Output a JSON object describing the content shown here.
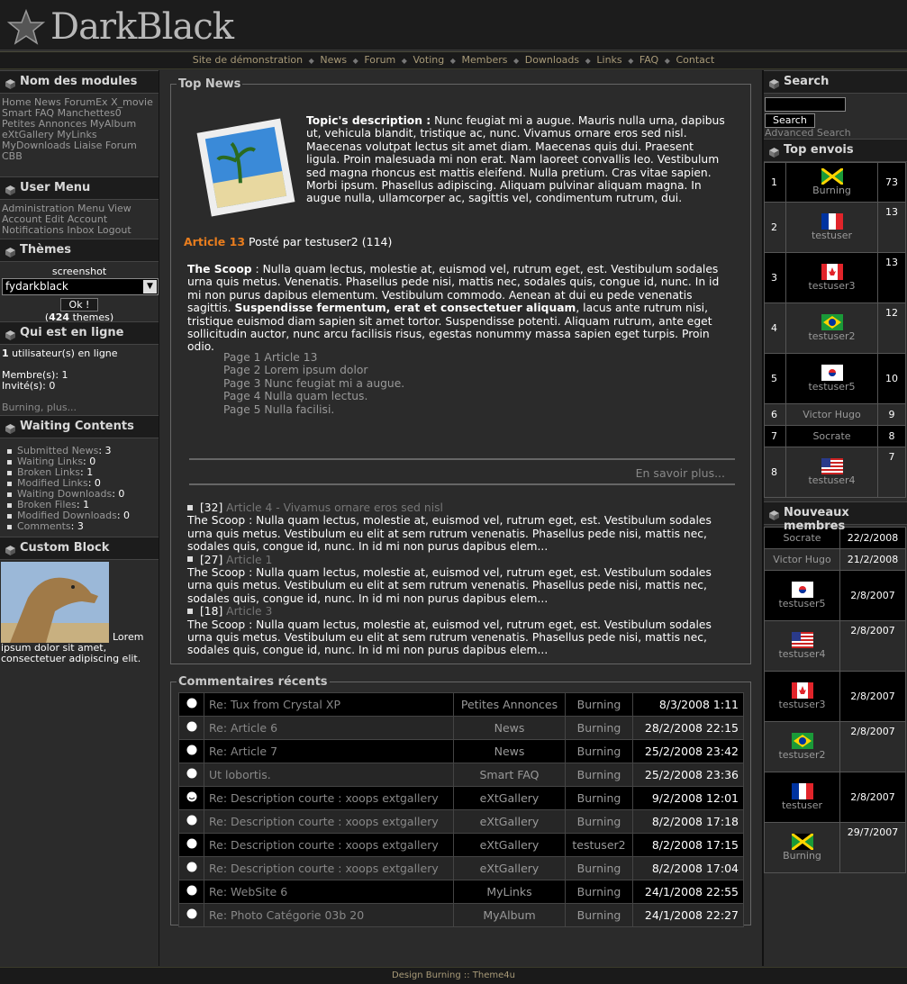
{
  "header": {
    "logo_text": "DarkBlack"
  },
  "nav": [
    "Site de démonstration",
    "News",
    "Forum",
    "Voting",
    "Members",
    "Downloads",
    "Links",
    "FAQ",
    "Contact"
  ],
  "left": {
    "modules": {
      "title": "Nom des modules",
      "items": [
        "Home",
        "News",
        "ForumEx",
        "X_movie",
        "Smart FAQ",
        "Manchettes0",
        "Petites Annonces",
        "MyAlbum",
        "eXtGallery",
        "MyLinks",
        "MyDownloads",
        "Liaise",
        "Forum",
        "CBB"
      ]
    },
    "usermenu": {
      "title": "User Menu",
      "items": [
        "Administration Menu",
        "View Account",
        "Edit Account",
        "Notifications",
        "Inbox",
        "Logout"
      ]
    },
    "themes": {
      "title": "Thèmes",
      "screenshot_label": "screenshot",
      "selected": "fydarkblack",
      "ok_label": "Ok !",
      "count": "424",
      "count_suffix": "themes"
    },
    "online": {
      "title": "Qui est en ligne",
      "users_count": "1",
      "users_label": "utilisateur(s) en ligne",
      "members_label": "Membre(s):",
      "members_count": "1",
      "guests_label": "Invité(s):",
      "guests_count": "0",
      "link": "Burning, plus..."
    },
    "waiting": {
      "title": "Waiting Contents",
      "items": [
        {
          "label": "Submitted News",
          "count": "3"
        },
        {
          "label": "Waiting Links",
          "count": "0"
        },
        {
          "label": "Broken Links",
          "count": "1"
        },
        {
          "label": "Modified Links",
          "count": "0"
        },
        {
          "label": "Waiting Downloads",
          "count": "0"
        },
        {
          "label": "Broken Files",
          "count": "1"
        },
        {
          "label": "Modified Downloads",
          "count": "0"
        },
        {
          "label": "Comments",
          "count": "3"
        }
      ]
    },
    "custom": {
      "title": "Custom Block",
      "text": "Lorem ipsum dolor sit amet, consectetuer adipiscing elit."
    }
  },
  "center": {
    "topnews": {
      "title": "Top News",
      "desc_label": "Topic's description :",
      "desc_text": "Nunc feugiat mi a augue. Mauris nulla urna, dapibus ut, vehicula blandit, tristique ac, nunc. Vivamus ornare eros sed nisl. Maecenas volutpat lectus sit amet diam. Maecenas quis dui. Praesent ligula. Proin malesuada mi non erat. Nam laoreet convallis leo. Vestibulum sed magna rhoncus est mattis eleifend. Nulla pretium. Cras vitae sapien. Morbi ipsum. Phasellus adipiscing. Aliquam pulvinar aliquam magna. In augue nulla, ullamcorper ac, sagittis vel, condimentum rutrum, dui.",
      "article_title": "Article 13",
      "posted_by": "Posté par testuser2 (114)",
      "scoop_label": "The Scoop",
      "body1": " : Nulla quam lectus, molestie at, euismod vel, rutrum eget, est. Vestibulum sodales urna quis metus. Venenatis. Phasellus pede nisi, mattis nec, sodales quis, congue id, nunc. In id mi non purus dapibus elementum. Vestibulum commodo. Aenean at dui eu pede venenatis sagittis. ",
      "body_bold": "Suspendisse fermentum, erat et consectetuer aliquam",
      "body2": ", lacus ante rutrum nisi, tristique euismod diam sapien sit amet tortor. Suspendisse potenti. Aliquam rutrum, ante eget sollicitudin auctor, nunc arcu facilisis risus, egestas nonummy massa sapien eget turpis. Proin odio.",
      "pages": [
        "Page 1 Article 13",
        "Page 2 Lorem ipsum dolor",
        "Page 3 Nunc feugiat mi a augue.",
        "Page 4 Nulla quam lectus.",
        "Page 5 Nulla facilisi."
      ],
      "more": "En savoir plus...",
      "list": [
        {
          "count": "[32]",
          "title": "Article 4 - Vivamus ornare eros sed nisl",
          "text": "The Scoop : Nulla quam lectus, molestie at, euismod vel, rutrum eget, est. Vestibulum sodales urna quis metus. Vestibulum eu elit at sem rutrum venenatis. Phasellus pede nisi, mattis nec, sodales quis, congue id, nunc. In id mi non purus dapibus elem..."
        },
        {
          "count": "[27]",
          "title": "Article 1",
          "text": "The Scoop : Nulla quam lectus, molestie at, euismod vel, rutrum eget, est. Vestibulum sodales urna quis metus. Vestibulum eu elit at sem rutrum venenatis. Phasellus pede nisi, mattis nec, sodales quis, congue id, nunc. In id mi non purus dapibus elem..."
        },
        {
          "count": "[18]",
          "title": "Article 3",
          "text": "The Scoop : Nulla quam lectus, molestie at, euismod vel, rutrum eget, est. Vestibulum sodales urna quis metus. Vestibulum eu elit at sem rutrum venenatis. Phasellus pede nisi, mattis nec, sodales quis, congue id, nunc. In id mi non purus dapibus elem..."
        }
      ]
    },
    "comments": {
      "title": "Commentaires récents",
      "rows": [
        {
          "subject": "Re: Tux from Crystal XP",
          "module": "Petites Annonces",
          "user": "Burning",
          "date": "8/3/2008 1:11"
        },
        {
          "subject": "Re: Article 6",
          "module": "News",
          "user": "Burning",
          "date": "28/2/2008 22:15"
        },
        {
          "subject": "Re: Article 7",
          "module": "News",
          "user": "Burning",
          "date": "25/2/2008 23:42"
        },
        {
          "subject": "Ut lobortis.",
          "module": "Smart FAQ",
          "user": "Burning",
          "date": "25/2/2008 23:36"
        },
        {
          "subject": "Re: Description courte : xoops extgallery",
          "module": "eXtGallery",
          "user": "Burning",
          "date": "9/2/2008 12:01"
        },
        {
          "subject": "Re: Description courte : xoops extgallery",
          "module": "eXtGallery",
          "user": "Burning",
          "date": "8/2/2008 17:18"
        },
        {
          "subject": "Re: Description courte : xoops extgallery",
          "module": "eXtGallery",
          "user": "testuser2",
          "date": "8/2/2008 17:15"
        },
        {
          "subject": "Re: Description courte : xoops extgallery",
          "module": "eXtGallery",
          "user": "Burning",
          "date": "8/2/2008 17:04"
        },
        {
          "subject": "Re: WebSite 6",
          "module": "MyLinks",
          "user": "Burning",
          "date": "24/1/2008 22:55"
        },
        {
          "subject": "Re: Photo Catégorie 03b 20",
          "module": "MyAlbum",
          "user": "Burning",
          "date": "24/1/2008 22:27"
        }
      ]
    }
  },
  "right": {
    "search": {
      "title": "Search",
      "button": "Search",
      "advanced": "Advanced Search"
    },
    "top": {
      "title": "Top envois",
      "rows": [
        {
          "rank": "1",
          "name": "Burning",
          "count": "73",
          "flag": "jamaica"
        },
        {
          "rank": "2",
          "name": "testuser",
          "count": "13",
          "flag": "france"
        },
        {
          "rank": "3",
          "name": "testuser3",
          "count": "13",
          "flag": "canada"
        },
        {
          "rank": "4",
          "name": "testuser2",
          "count": "12",
          "flag": "brazil"
        },
        {
          "rank": "5",
          "name": "testuser5",
          "count": "10",
          "flag": "korea"
        },
        {
          "rank": "6",
          "name": "Victor Hugo",
          "count": "9",
          "flag": ""
        },
        {
          "rank": "7",
          "name": "Socrate",
          "count": "8",
          "flag": ""
        },
        {
          "rank": "8",
          "name": "testuser4",
          "count": "7",
          "flag": "usa"
        }
      ]
    },
    "newmembers": {
      "title": "Nouveaux membres",
      "rows": [
        {
          "name": "Socrate",
          "date": "22/2/2008",
          "flag": ""
        },
        {
          "name": "Victor Hugo",
          "date": "21/2/2008",
          "flag": ""
        },
        {
          "name": "testuser5",
          "date": "2/8/2007",
          "flag": "korea"
        },
        {
          "name": "testuser4",
          "date": "2/8/2007",
          "flag": "usa"
        },
        {
          "name": "testuser3",
          "date": "2/8/2007",
          "flag": "canada"
        },
        {
          "name": "testuser2",
          "date": "2/8/2007",
          "flag": "brazil"
        },
        {
          "name": "testuser",
          "date": "2/8/2007",
          "flag": "france"
        },
        {
          "name": "Burning",
          "date": "29/7/2007",
          "flag": "jamaica"
        }
      ]
    }
  },
  "footer": {
    "text": "Design Burning :: Theme4u"
  }
}
